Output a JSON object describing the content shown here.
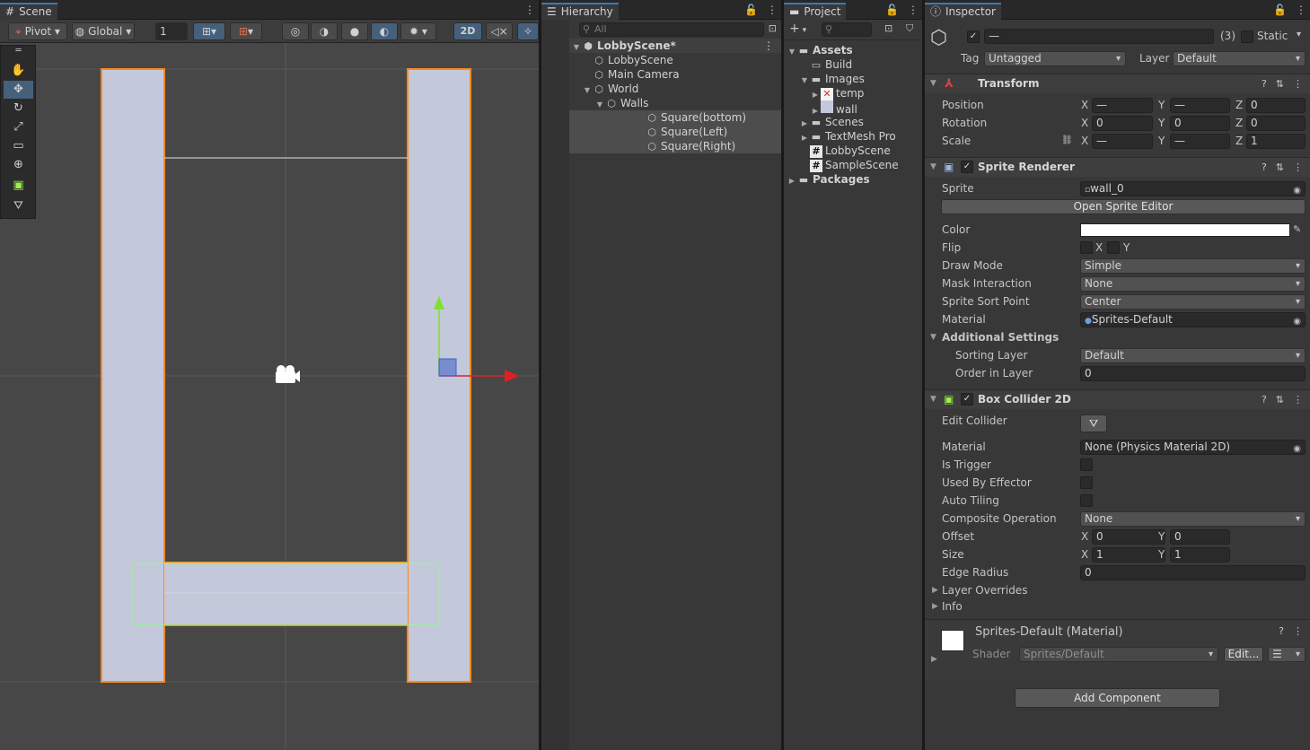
{
  "scene": {
    "tab": "Scene",
    "pivot": "Pivot",
    "global": "Global",
    "grid_value": "1",
    "mode_2d": "2D",
    "tools": [
      "hand-tool",
      "move-tool",
      "rotate-tool",
      "scale-tool",
      "rect-tool",
      "transform-tool",
      "collider-tool",
      "edit-collider-tool"
    ]
  },
  "hierarchy": {
    "tab": "Hierarchy",
    "search_placeholder": "All",
    "items": [
      "LobbyScene*",
      "LobbyScene",
      "Main Camera",
      "World",
      "Walls",
      "Square(bottom)",
      "Square(Left)",
      "Square(Right)"
    ]
  },
  "project": {
    "tab": "Project",
    "items": [
      "Assets",
      "Build",
      "Images",
      "temp",
      "wall",
      "Scenes",
      "TextMesh Pro",
      "LobbyScene",
      "SampleScene",
      "Packages"
    ]
  },
  "inspector": {
    "tab": "Inspector",
    "name_value": "—",
    "count": "(3)",
    "static_label": "Static",
    "tag_label": "Tag",
    "tag_value": "Untagged",
    "layer_label": "Layer",
    "layer_value": "Default",
    "transform": {
      "title": "Transform",
      "position_label": "Position",
      "rotation_label": "Rotation",
      "scale_label": "Scale",
      "position": [
        "—",
        "—",
        "0"
      ],
      "rotation": [
        "0",
        "0",
        "0"
      ],
      "scale": [
        "—",
        "—",
        "1"
      ]
    },
    "sprite_renderer": {
      "title": "Sprite Renderer",
      "sprite_label": "Sprite",
      "sprite_value": "wall_0",
      "open_editor": "Open Sprite Editor",
      "color_label": "Color",
      "flip_label": "Flip",
      "flip_x": "X",
      "flip_y": "Y",
      "draw_mode_label": "Draw Mode",
      "draw_mode_value": "Simple",
      "mask_label": "Mask Interaction",
      "mask_value": "None",
      "sort_point_label": "Sprite Sort Point",
      "sort_point_value": "Center",
      "material_label": "Material",
      "material_value": "Sprites-Default",
      "additional_label": "Additional Settings",
      "sorting_layer_label": "Sorting Layer",
      "sorting_layer_value": "Default",
      "order_label": "Order in Layer",
      "order_value": "0"
    },
    "box_collider": {
      "title": "Box Collider 2D",
      "edit_label": "Edit Collider",
      "material_label": "Material",
      "material_value": "None (Physics Material 2D)",
      "trigger_label": "Is Trigger",
      "effector_label": "Used By Effector",
      "tiling_label": "Auto Tiling",
      "composite_label": "Composite Operation",
      "composite_value": "None",
      "offset_label": "Offset",
      "offset": [
        "0",
        "0"
      ],
      "size_label": "Size",
      "size": [
        "1",
        "1"
      ],
      "edge_label": "Edge Radius",
      "edge_value": "0",
      "layer_overrides": "Layer Overrides",
      "info": "Info"
    },
    "material": {
      "title": "Sprites-Default (Material)",
      "shader_label": "Shader",
      "shader_value": "Sprites/Default",
      "edit_button": "Edit..."
    },
    "add_component": "Add Component",
    "colors": {
      "selection_orange": "#ff8a1f",
      "collider_green": "#9cf09c",
      "wall_fill": "#c3c8da",
      "accent_blue": "#3a79bb"
    }
  }
}
